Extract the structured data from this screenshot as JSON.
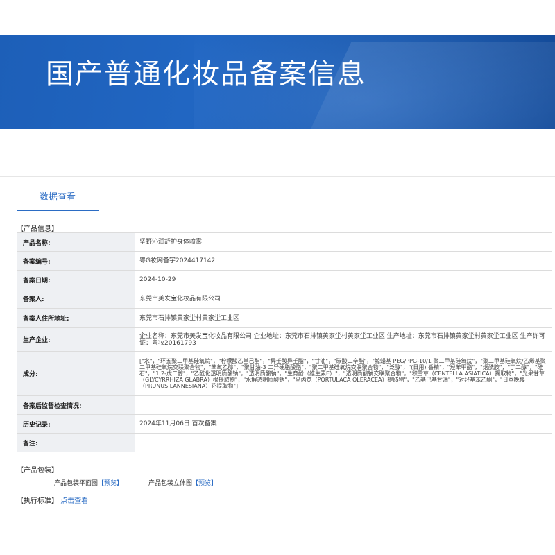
{
  "banner": {
    "title": "国产普通化妆品备案信息"
  },
  "tabs": [
    {
      "label": "数据查看",
      "active": true
    }
  ],
  "sections": {
    "product_info": "【产品信息】",
    "packaging": "【产品包装】",
    "standard": "【执行标准】"
  },
  "info_rows": [
    {
      "label": "产品名称:",
      "value": "坚野沁润舒护身体喷雾"
    },
    {
      "label": "备案编号:",
      "value": "粤G妆网备字2024417142"
    },
    {
      "label": "备案日期:",
      "value": "2024-10-29"
    },
    {
      "label": "备案人:",
      "value": "东莞市美发宝化妆品有限公司"
    },
    {
      "label": "备案人住所地址:",
      "value": "东莞市石排镇黄家坣村黄家坣工业区"
    },
    {
      "label": "生产企业:",
      "value": "企业名称：东莞市美发宝化妆品有限公司 企业地址：东莞市石排镇黄家坣村黄家坣工业区 生产地址：东莞市石排镇黄家坣村黄家坣工业区 生产许可证：粤妆20161793"
    },
    {
      "label": "成分:",
      "value": "[\"水\"，\"环五聚二甲基硅氧烷\"，\"柠檬酸乙基己酯\"，\"异壬酸异壬酯\"，\"甘油\"，\"碳酸二辛酯\"，\"鲸蜡基 PEG/PPG-10/1 聚二甲基硅氧烷\"，\"聚二甲基硅氧烷/乙烯基聚二甲基硅氧烷交联聚合物\"，\"苯氧乙醇\"，\"聚甘油-3 二异硬脂酸酯\"，\"聚二甲基硅氧烷交联聚合物\"，\"泛醇\"，\"(日用) 香精\"，\"羟苯甲酯\"，\"烟酰胺\"，\"丁二醇\"，\"硅石\"，\"1,2-戊二醇\"，\"乙酰化透明质酸钠\"，\"透明质酸钠\"，\"生育酚（维生素E）\"，\"透明质酸钠交联聚合物\"，\"积雪草（CENTELLA ASIATICA）提取物\"，\"光果甘草（GLYCYRRHIZA GLABRA）根提取物\"，\"水解透明质酸钠\"，\"马齿苋（PORTULACA OLERACEA）提取物\"，\"乙基己基甘油\"，\"对羟基苯乙酮\"，\"日本晚樱（PRUNUS LANNESIANA）花提取物\"]"
    },
    {
      "label": "备案后监督检查情况:",
      "value": ""
    },
    {
      "label": "历史记录:",
      "value": "2024年11月06日 首次备案"
    },
    {
      "label": "备注:",
      "value": ""
    }
  ],
  "packaging": {
    "flat_label": "产品包装平面图",
    "flat_link": "【预览】",
    "solid_label": "产品包装立体图",
    "solid_link": "【预览】"
  },
  "standard": {
    "link": "点击查看"
  }
}
